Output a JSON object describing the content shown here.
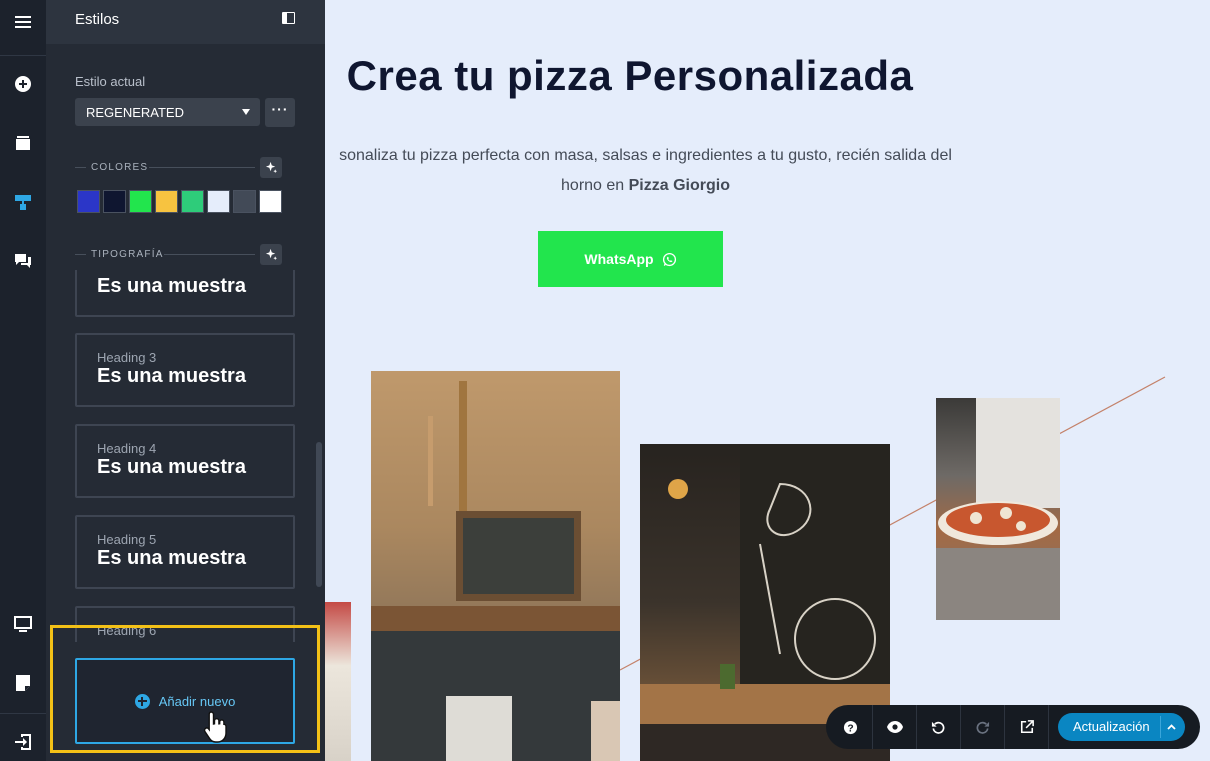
{
  "panel": {
    "title": "Estilos",
    "current_style_label": "Estilo actual",
    "current_style_value": "REGENERATED",
    "more_label": "···",
    "colors_label": "COLORES",
    "typography_label": "TIPOGRAFÍA",
    "colors": [
      "#2b36c8",
      "#0f1630",
      "#22e54d",
      "#f7c340",
      "#2ecc7a",
      "#e5edfb",
      "#424a57",
      "#ffffff"
    ],
    "typography": [
      {
        "name": "",
        "sample": "Es una muestra"
      },
      {
        "name": "Heading 3",
        "sample": "Es una muestra"
      },
      {
        "name": "Heading 4",
        "sample": "Es una muestra"
      },
      {
        "name": "Heading 5",
        "sample": "Es una muestra"
      },
      {
        "name": "Heading 6",
        "sample": ""
      }
    ],
    "add_new_label": "Añadir nuevo"
  },
  "rail": {
    "icons": [
      "menu-icon",
      "add-icon",
      "layers-icon",
      "paint-roller-icon",
      "comments-icon",
      "desktop-icon",
      "page-icon",
      "exit-icon"
    ]
  },
  "site": {
    "title": "Crea tu pizza Personalizada",
    "desc_line1": "sonaliza tu pizza perfecta con masa, salsas e ingredientes a tu gusto, recién salida del",
    "desc_line2_prefix": "horno en ",
    "desc_line2_bold": "Pizza Giorgio",
    "whatsapp_label": "WhatsApp",
    "brand_color": "#22e54d"
  },
  "toolbar": {
    "icons": [
      "help-icon",
      "preview-eye-icon",
      "undo-icon",
      "redo-icon",
      "external-link-icon"
    ],
    "update_label": "Actualización"
  }
}
